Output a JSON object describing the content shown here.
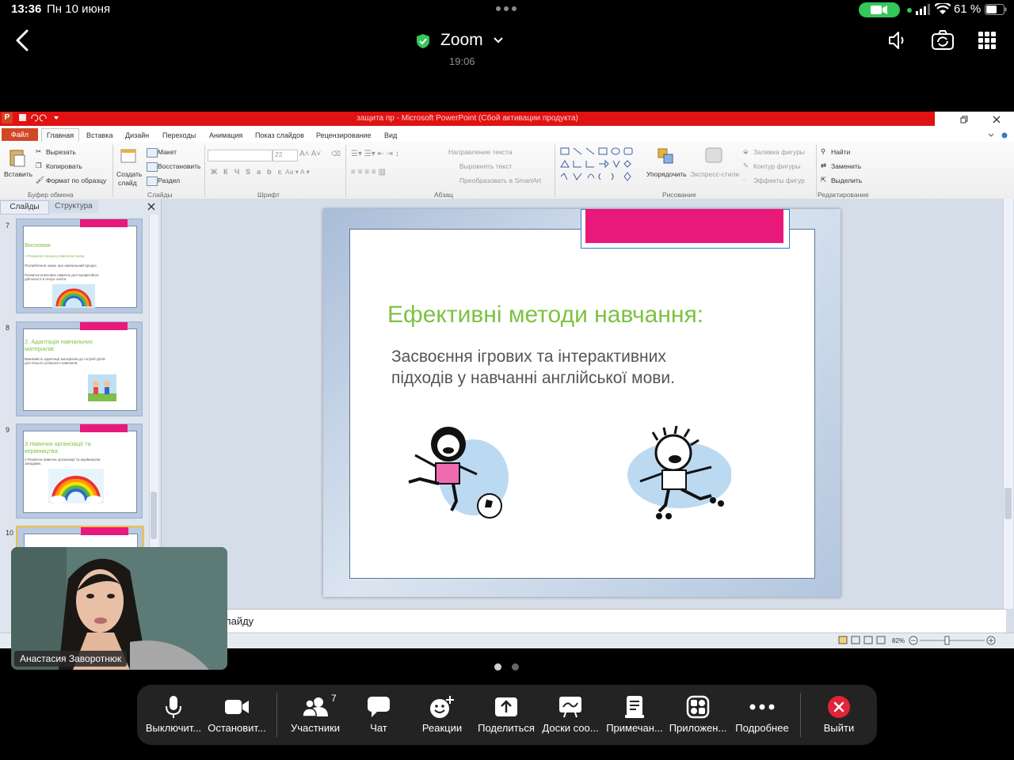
{
  "status_bar": {
    "time": "13:36",
    "date": "Пн 10 июня",
    "battery": "61 %"
  },
  "zoom_header": {
    "title": "Zoom",
    "meeting_time": "19:06"
  },
  "powerpoint": {
    "window_title": "защита пр - Microsoft PowerPoint (Сбой активации продукта)",
    "file_tab": "Файл",
    "tabs": [
      "Главная",
      "Вставка",
      "Дизайн",
      "Переходы",
      "Анимация",
      "Показ слайдов",
      "Рецензирование",
      "Вид"
    ],
    "ribbon": {
      "paste": "Вставить",
      "cut": "Вырезать",
      "copy": "Копировать",
      "format_painter": "Формат по образцу",
      "clipboard_group": "Буфер обмена",
      "new_slide_1": "Создать",
      "new_slide_2": "слайд",
      "layout": "Макет",
      "reset": "Восстановить",
      "section": "Раздел",
      "slides_group": "Слайды",
      "font_size": "22",
      "font_group": "Шрифт",
      "text_direction": "Направление текста",
      "align_text": "Выровнять текст",
      "smartart": "Преобразовать в SmartArt",
      "paragraph_group": "Абзац",
      "arrange": "Упорядочить",
      "quick_styles": "Экспресс-стили",
      "shape_fill": "Заливка фигуры",
      "shape_outline": "Контур фигуры",
      "shape_effects": "Эффекты фигур",
      "drawing_group": "Рисование",
      "find": "Найти",
      "replace": "Заменить",
      "select": "Выделить",
      "editing_group": "Редактирование"
    },
    "panel_tabs": [
      "Слайды",
      "Структура"
    ],
    "thumbnails": [
      {
        "num": "7",
        "title": "Висновки",
        "lines": [
          "1.Розуміння процесу вивчення мови:",
          "Поглиблення знань про навчальний процес.",
          "Розвиток ключових навичок для професійної діяльності в галузі освіти."
        ]
      },
      {
        "num": "8",
        "title": "2. Адаптація навчальних матеріалів:",
        "lines": [
          "Важливість адаптації матеріалів до потреб дітей для їхнього успішного навчання."
        ]
      },
      {
        "num": "9",
        "title": "3.Навички організації та керівництва:",
        "lines": [
          "o Розвиток навичок організації та керівництва заходами."
        ]
      },
      {
        "num": "10",
        "title": "",
        "lines": []
      }
    ],
    "slide": {
      "title": "Ефективні методи навчання:",
      "subtitle": "Засвоєння ігрових та інтерактивних підходів у навчанні англійської мови."
    },
    "notes_text": "лайду",
    "zoom_level": "82%"
  },
  "self_video": {
    "name": "Анастасия Заворотнюк"
  },
  "toolbar": {
    "participants_count": "7",
    "buttons": [
      {
        "label": "Выключит...",
        "icon": "microphone-icon"
      },
      {
        "label": "Остановит...",
        "icon": "video-camera-icon"
      },
      {
        "label": "Участники",
        "icon": "participants-icon"
      },
      {
        "label": "Чат",
        "icon": "chat-icon"
      },
      {
        "label": "Реакции",
        "icon": "reactions-icon"
      },
      {
        "label": "Поделиться",
        "icon": "share-screen-icon"
      },
      {
        "label": "Доски соо...",
        "icon": "whiteboard-icon"
      },
      {
        "label": "Примечан...",
        "icon": "notes-icon"
      },
      {
        "label": "Приложен...",
        "icon": "apps-icon"
      },
      {
        "label": "Подробнее",
        "icon": "more-icon"
      },
      {
        "label": "Выйти",
        "icon": "leave-icon"
      }
    ]
  },
  "colors": {
    "accent_green": "#34c759",
    "leave_red": "#e0243a",
    "slide_title_green": "#7dc242",
    "slide_pink": "#e8197a",
    "ppt_titlebar_red": "#e01212"
  }
}
